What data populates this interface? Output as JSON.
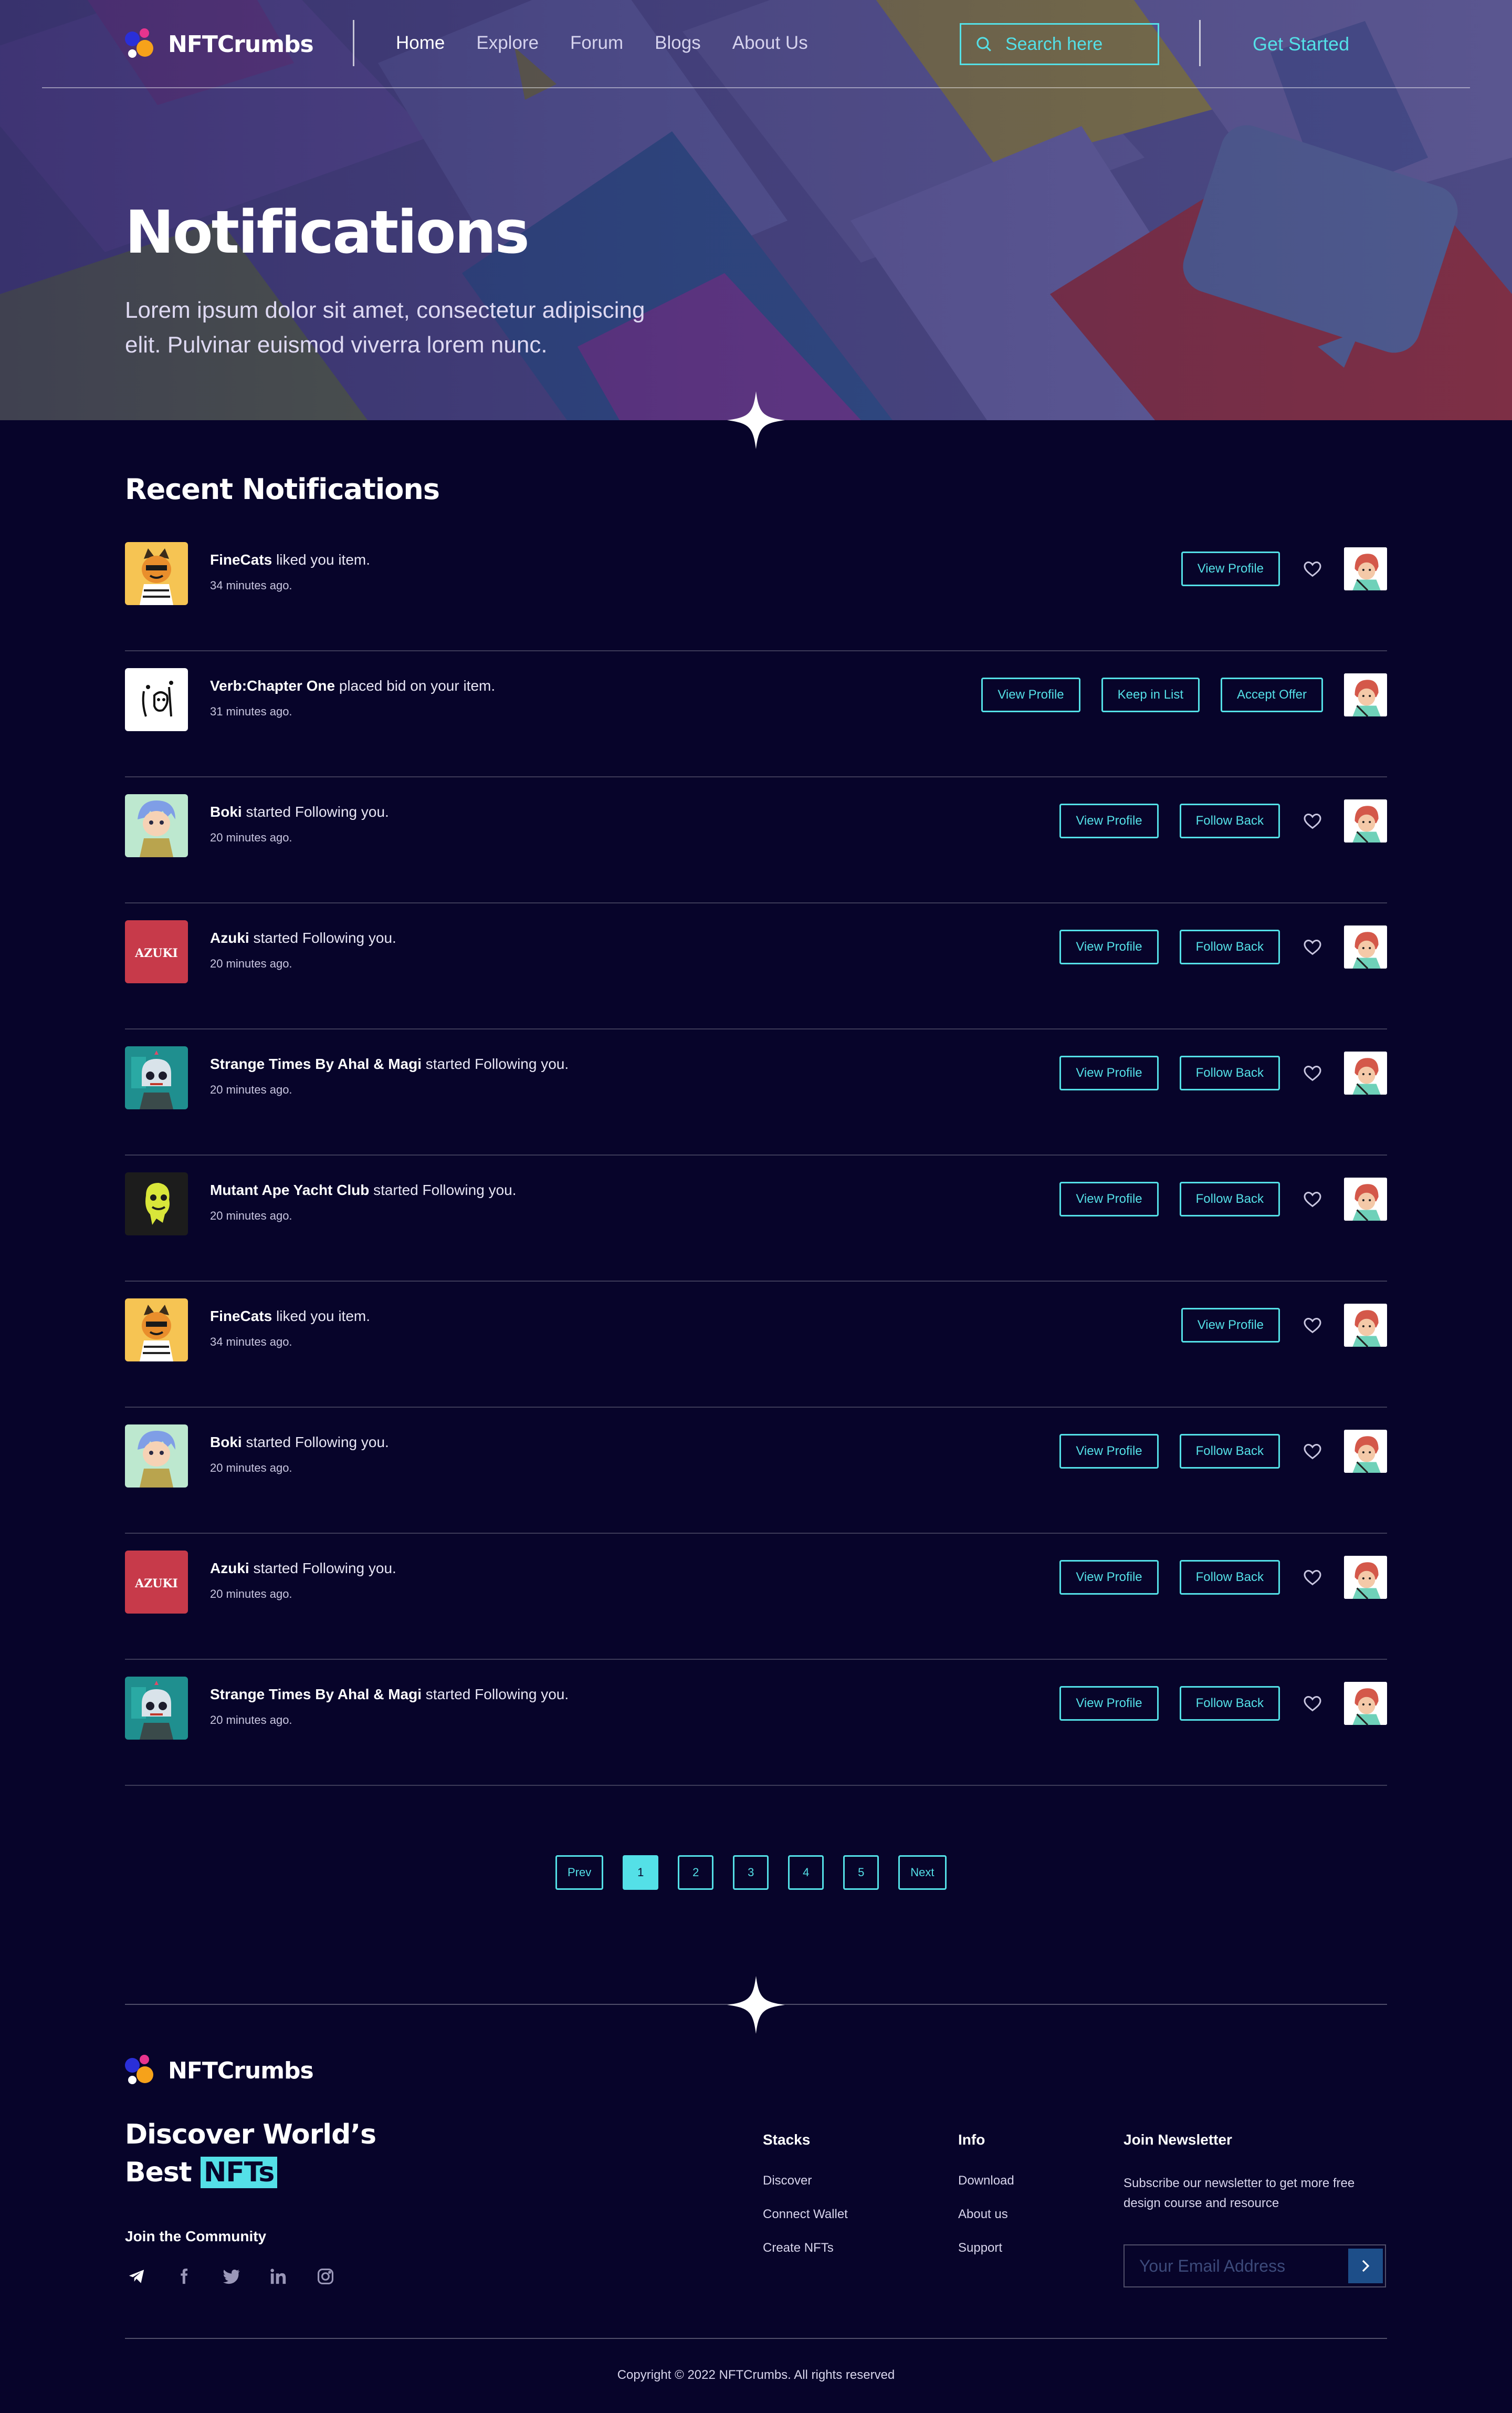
{
  "brand": {
    "name": "NFTCrumbs"
  },
  "nav": {
    "links": [
      {
        "label": "Home",
        "active": true
      },
      {
        "label": "Explore"
      },
      {
        "label": "Forum"
      },
      {
        "label": "Blogs"
      },
      {
        "label": "About Us"
      }
    ],
    "search_placeholder": "Search here",
    "cta_label": "Get Started"
  },
  "hero": {
    "title": "Notifications",
    "subtitle": "Lorem ipsum dolor sit amet, consectetur adipiscing elit. Pulvinar euismod viverra lorem nunc."
  },
  "notifications": {
    "title": "Recent Notifications",
    "items": [
      {
        "actor": "FineCats",
        "text": "liked you item.",
        "time": "34 minutes ago.",
        "thumb": "finecats",
        "actions": [
          "View Profile"
        ],
        "heart": true
      },
      {
        "actor": "Verb:Chapter One",
        "text": "placed bid on your item.",
        "time": "31 minutes ago.",
        "thumb": "verb",
        "actions": [
          "View Profile",
          "Keep in List",
          "Accept Offer"
        ],
        "heart": false
      },
      {
        "actor": "Boki",
        "text": "started Following you.",
        "time": "20 minutes ago.",
        "thumb": "boki",
        "actions": [
          "View Profile",
          "Follow Back"
        ],
        "heart": true
      },
      {
        "actor": "Azuki",
        "text": "started Following you.",
        "time": "20 minutes ago.",
        "thumb": "azuki",
        "actions": [
          "View Profile",
          "Follow Back"
        ],
        "heart": true
      },
      {
        "actor": "Strange Times By Ahal & Magi",
        "text": "started Following you.",
        "time": "20 minutes ago.",
        "thumb": "strange",
        "actions": [
          "View Profile",
          "Follow Back"
        ],
        "heart": true
      },
      {
        "actor": "Mutant Ape Yacht Club",
        "text": "started Following you.",
        "time": "20 minutes ago.",
        "thumb": "mutant",
        "actions": [
          "View Profile",
          "Follow Back"
        ],
        "heart": true
      },
      {
        "actor": "FineCats",
        "text": "liked you item.",
        "time": "34 minutes ago.",
        "thumb": "finecats",
        "actions": [
          "View Profile"
        ],
        "heart": true
      },
      {
        "actor": "Boki",
        "text": "started Following you.",
        "time": "20 minutes ago.",
        "thumb": "boki",
        "actions": [
          "View Profile",
          "Follow Back"
        ],
        "heart": true
      },
      {
        "actor": "Azuki",
        "text": "started Following you.",
        "time": "20 minutes ago.",
        "thumb": "azuki",
        "actions": [
          "View Profile",
          "Follow Back"
        ],
        "heart": true
      },
      {
        "actor": "Strange Times By Ahal & Magi",
        "text": "started Following you.",
        "time": "20 minutes ago.",
        "thumb": "strange",
        "actions": [
          "View Profile",
          "Follow Back"
        ],
        "heart": true
      }
    ]
  },
  "pagination": {
    "prev": "Prev",
    "next": "Next",
    "pages": [
      "1",
      "2",
      "3",
      "4",
      "5"
    ],
    "current": "1"
  },
  "footer": {
    "tagline_line1": "Discover World’s",
    "tagline_line2_prefix": "Best",
    "tagline_highlight": "NFTs",
    "community_title": "Join the Community",
    "socials": [
      "telegram-icon",
      "facebook-icon",
      "twitter-icon",
      "linkedin-icon",
      "instagram-icon"
    ],
    "columns": [
      {
        "title": "Stacks",
        "links": [
          "Discover",
          "Connect Wallet",
          "Create NFTs"
        ]
      },
      {
        "title": "Info",
        "links": [
          "Download",
          "About us",
          "Support"
        ]
      }
    ],
    "newsletter": {
      "title": "Join Newsletter",
      "text": "Subscribe our newsletter to get more free design course and resource",
      "placeholder": "Your Email Address"
    },
    "copyright": "Copyright © 2022 NFTCrumbs. All rights reserved"
  },
  "colors": {
    "background": "#07042a",
    "accent": "#54e0e7",
    "azuki_red": "#c73a4a"
  }
}
